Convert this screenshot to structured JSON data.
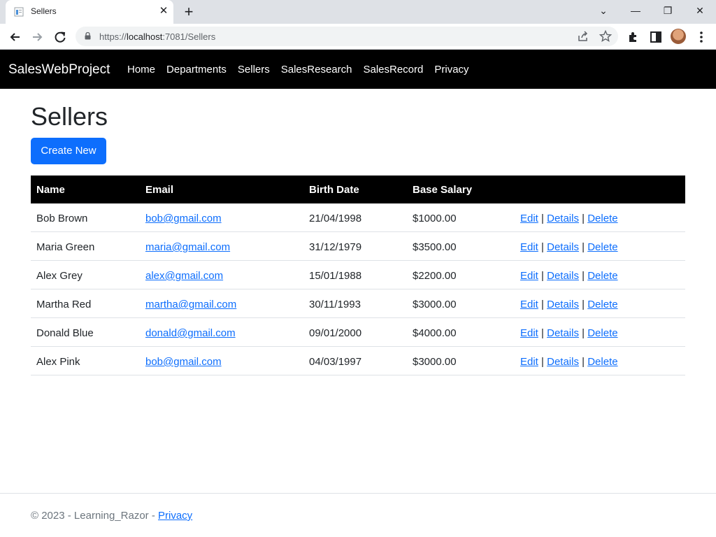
{
  "browser": {
    "tab_title": "Sellers",
    "tab_close": "✕",
    "new_tab": "+",
    "url_prefix": "https://",
    "url_host": "localhost",
    "url_path": ":7081/Sellers",
    "minimize": "—",
    "restore": "❐",
    "close": "✕",
    "chevron": "⌄",
    "icons": [
      "back-icon",
      "forward-icon",
      "reload-icon",
      "lock-icon",
      "share-icon",
      "star-icon",
      "extensions-icon",
      "sidepanel-icon",
      "profile-avatar",
      "menu-icon"
    ]
  },
  "navbar": {
    "brand": "SalesWebProject",
    "links": [
      "Home",
      "Departments",
      "Sellers",
      "SalesResearch",
      "SalesRecord",
      "Privacy"
    ]
  },
  "page": {
    "title": "Sellers",
    "create_label": "Create New"
  },
  "table": {
    "headers": [
      "Name",
      "Email",
      "Birth Date",
      "Base Salary"
    ],
    "action_labels": {
      "edit": "Edit",
      "details": "Details",
      "delete": "Delete",
      "separator": "|"
    },
    "rows": [
      {
        "name": "Bob Brown",
        "email": "bob@gmail.com",
        "birth_date": "21/04/1998",
        "salary": "$1000.00"
      },
      {
        "name": "Maria Green",
        "email": "maria@gmail.com",
        "birth_date": "31/12/1979",
        "salary": "$3500.00"
      },
      {
        "name": "Alex Grey",
        "email": "alex@gmail.com",
        "birth_date": "15/01/1988",
        "salary": "$2200.00"
      },
      {
        "name": "Martha Red",
        "email": "martha@gmail.com",
        "birth_date": "30/11/1993",
        "salary": "$3000.00"
      },
      {
        "name": "Donald Blue",
        "email": "donald@gmail.com",
        "birth_date": "09/01/2000",
        "salary": "$4000.00"
      },
      {
        "name": "Alex Pink",
        "email": "bob@gmail.com",
        "birth_date": "04/03/1997",
        "salary": "$3000.00"
      }
    ]
  },
  "footer": {
    "text": "© 2023 - Learning_Razor - ",
    "privacy": "Privacy"
  },
  "colors": {
    "primary": "#0d6efd",
    "navbar_bg": "#000000",
    "header_bg": "#000000"
  }
}
